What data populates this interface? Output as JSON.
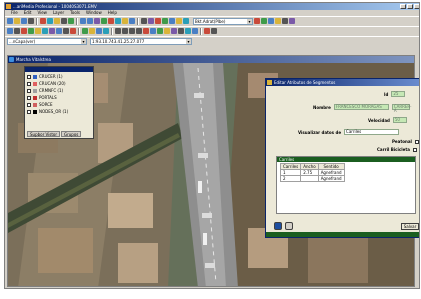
{
  "window": {
    "title": "...ariMedia Profesional - 10040S3071.EMV"
  },
  "menu": [
    "File",
    "Edit",
    "View",
    "Layer",
    "Tools",
    "Window",
    "Help"
  ],
  "toolbar": {
    "layer_combo": "...nCapa(ver)",
    "coord_combo": "1:93.10.743.41.25.27.077",
    "filter_combo": "Bkt.Adrat(Plbe)"
  },
  "map_window": {
    "title": "Marcha Vitalstrea"
  },
  "layers_panel": {
    "items": [
      {
        "label": "CRUCER (1)",
        "color": "#3060c0"
      },
      {
        "label": "CRUCAN (20)",
        "color": "#e06060"
      },
      {
        "label": "CRMNFC (1)",
        "color": "#a0a0a0"
      },
      {
        "label": "PORTALS",
        "color": "#c03030"
      },
      {
        "label": "SORCE",
        "color": "#d06060"
      },
      {
        "label": "NODES_OR (1)",
        "color": "#000000"
      }
    ],
    "tabs": [
      "Supbor Vistor",
      "Grupos"
    ]
  },
  "dialog": {
    "title": "Editar Atributos de Segmentos",
    "id_label": "Id",
    "id_value": "25",
    "nombre_label": "Nombre",
    "nombre_value": "FRANCESCO MORAGAS",
    "nombre_code": "CARRER-A",
    "velocidad_label": "Velocidad",
    "velocidad_value": "50",
    "visualizar_label": "Visualizar datos de",
    "visualizar_value": "Carriles",
    "peatonal_label": "Peatonal",
    "carril_label": "Carril Bicicleta",
    "cambios_title": "Carriles",
    "cambios_headers": [
      "Carriles",
      "Ancho",
      "Sentido"
    ],
    "cambios_rows": [
      {
        "carril": "1",
        "ancho": "2.75",
        "sentido": "Agnefrand"
      },
      {
        "carril": "2",
        "ancho": "",
        "sentido": "Agnefrand"
      }
    ],
    "salvar_label": "Salvar"
  }
}
